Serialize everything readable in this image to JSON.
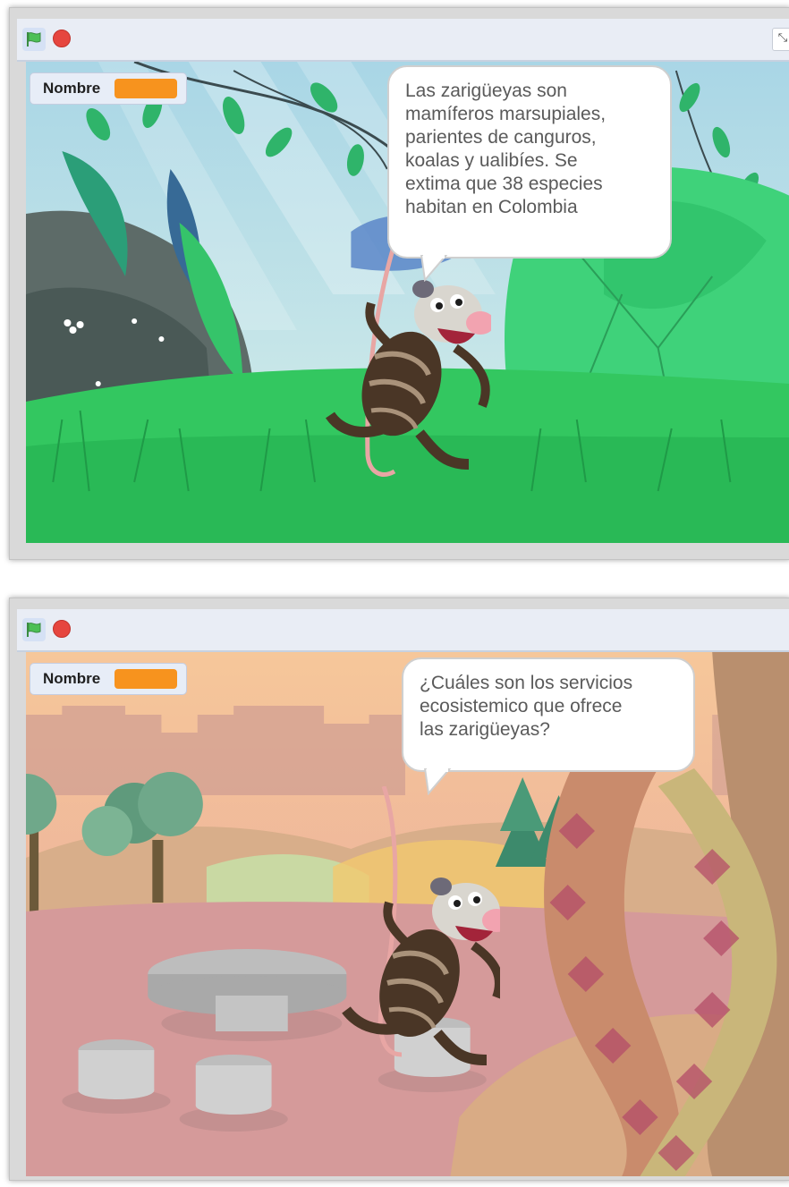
{
  "windows": [
    {
      "toolbar": {
        "flag": "green-flag-icon",
        "stop": "stop-icon",
        "fullscreen_glyph": "⤡"
      },
      "variable": {
        "label": "Nombre"
      },
      "speech": "Las zarigüeyas son\nmamíferos marsupiales,\nparientes de canguros,\nkoalas y ualibíes. Se\nextima que 38 especies\nhabitan en Colombia",
      "backdrop": "jungle"
    },
    {
      "toolbar": {
        "flag": "green-flag-icon",
        "stop": "stop-icon"
      },
      "variable": {
        "label": "Nombre"
      },
      "speech": "¿Cuáles son los servicios\necosistemico que ofrece\nlas zarigüeyas?",
      "backdrop": "park"
    }
  ],
  "colors": {
    "variable_value": "#f7931e",
    "flag": "#4cbf56",
    "stop": "#e6463f"
  }
}
